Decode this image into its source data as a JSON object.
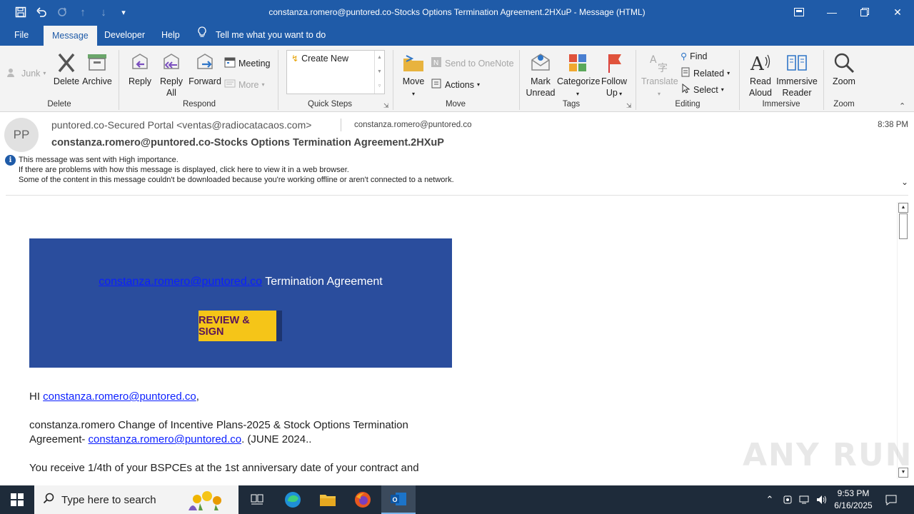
{
  "window": {
    "title": "constanza.romero@puntored.co-Stocks Options Termination Agreement.2HXuP  -  Message (HTML)"
  },
  "menu": {
    "tabs": [
      "File",
      "Message",
      "Developer",
      "Help"
    ],
    "active_tab": "Message",
    "tell_me": "Tell me what you want to do"
  },
  "ribbon": {
    "delete_group": {
      "junk": "Junk",
      "delete": "Delete",
      "archive": "Archive",
      "label": "Delete"
    },
    "respond_group": {
      "reply": "Reply",
      "reply_all_1": "Reply",
      "reply_all_2": "All",
      "forward": "Forward",
      "meeting": "Meeting",
      "more": "More",
      "label": "Respond"
    },
    "quick_steps": {
      "create_new": "Create New",
      "label": "Quick Steps"
    },
    "move_group": {
      "move": "Move",
      "send_onenote": "Send to OneNote",
      "actions": "Actions",
      "label": "Move"
    },
    "tags_group": {
      "mark_unread_1": "Mark",
      "mark_unread_2": "Unread",
      "categorize": "Categorize",
      "follow_up_1": "Follow",
      "follow_up_2": "Up",
      "label": "Tags"
    },
    "editing_group": {
      "translate": "Translate",
      "find": "Find",
      "related": "Related",
      "select": "Select",
      "label": "Editing"
    },
    "immersive_group": {
      "read_aloud_1": "Read",
      "read_aloud_2": "Aloud",
      "immersive_reader_1": "Immersive",
      "immersive_reader_2": "Reader",
      "label": "Immersive"
    },
    "zoom_group": {
      "zoom": "Zoom",
      "label": "Zoom"
    }
  },
  "message": {
    "avatar_initials": "PP",
    "from": "puntored.co-Secured Portal <ventas@radiocatacaos.com>",
    "to": "constanza.romero@puntored.co",
    "time": "8:38 PM",
    "subject": "constanza.romero@puntored.co-Stocks Options Termination Agreement.2HXuP",
    "info_lines": [
      "This message was sent with High importance.",
      "If there are problems with how this message is displayed, click here to view it in a web browser.",
      "Some of the content in this message couldn't be downloaded because you're working offline or aren't connected to a network."
    ]
  },
  "body": {
    "banner_link": "constanza.romero@puntored.co",
    "banner_text": " Termination Agreement",
    "button": "REVIEW & SIGN",
    "greeting_prefix": "HI ",
    "greeting_link": "constanza.romero@puntored.co",
    "greeting_suffix": ",",
    "para1_line1": "constanza.romero Change of Incentive Plans-2025 & Stock Options Termination",
    "para1_line2_prefix": "Agreement- ",
    "para1_link": "constanza.romero@puntored.co",
    "para1_suffix": ". (JUNE 2024..",
    "para2_line1": "You receive 1/4th of your BSPCEs at the 1st anniversary date of your contract and"
  },
  "watermark": "ANY RUN",
  "taskbar": {
    "search_placeholder": "Type here to search",
    "time": "9:53 PM",
    "date": "6/16/2025"
  },
  "colors": {
    "title_bar": "#1f5ba8",
    "banner": "#2a4d9d",
    "button_bg": "#f5c518",
    "button_text": "#5b1458",
    "link": "#0b1fff"
  }
}
